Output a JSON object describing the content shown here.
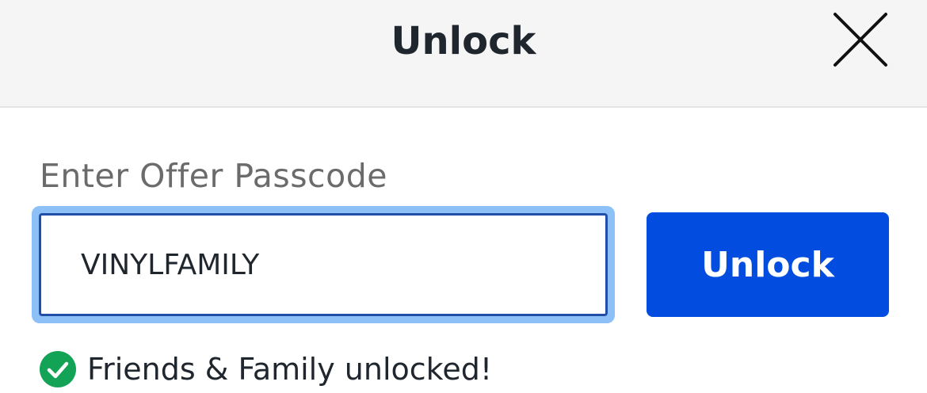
{
  "header": {
    "title": "Unlock",
    "close_icon": "close-icon"
  },
  "form": {
    "label": "Enter Offer Passcode",
    "input_value": "VINYLFAMILY",
    "button_label": "Unlock"
  },
  "status": {
    "icon": "check-circle-icon",
    "text": "Friends & Family unlocked!"
  },
  "colors": {
    "primary": "#024ddf",
    "success": "#13a356",
    "focus_ring": "#8cc0f7",
    "header_bg": "#f5f5f5"
  }
}
